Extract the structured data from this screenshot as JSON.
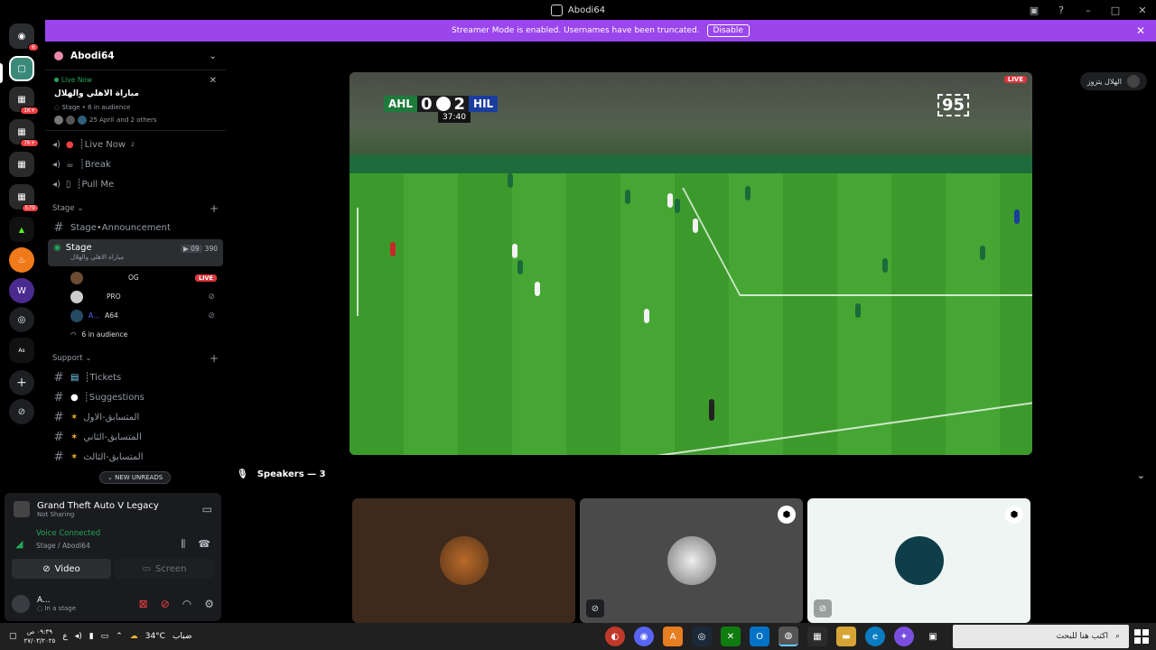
{
  "window": {
    "title": "Abodi64"
  },
  "banner": {
    "text": "Streamer Mode is enabled. Usernames have been truncated.",
    "disable_label": "Disable"
  },
  "rail": {
    "home_badge": "6",
    "badges": [
      "1K+",
      "7K+",
      "579"
    ]
  },
  "server": {
    "name": "Abodi64"
  },
  "live_now": {
    "label": "Live Now",
    "title": "مباراة الاهلي والهلال",
    "meta": "Stage • 6 in audience",
    "date_text": "25 April",
    "others": "and 2 others"
  },
  "channels_top": [
    {
      "name": "┊Live Now",
      "sup": "2"
    },
    {
      "name": "┊Break"
    },
    {
      "name": "┊Pull Me"
    }
  ],
  "stage_category": "Stage",
  "announcement_channel": "Stage•Announcement",
  "stage_channel": {
    "name": "Stage",
    "subtitle": "مباراة الاهلي والهلال",
    "count_a": "09",
    "count_b": "390"
  },
  "stage_members": [
    {
      "tag": "OG",
      "live": "LIVE"
    },
    {
      "tag": "PRO"
    },
    {
      "name": "A...",
      "tag": "A64"
    }
  ],
  "audience": "6 in audience",
  "support_category": "Support",
  "support_channels": [
    {
      "name": "┊Tickets"
    },
    {
      "name": "┊Suggestions"
    },
    {
      "name": "المتسابق-الاول"
    },
    {
      "name": "المتسابق-الثاني"
    },
    {
      "name": "المتسابق-الثالث"
    }
  ],
  "new_unreads": "NEW UNREADS",
  "activity": {
    "game": "Grand Theft Auto V Legacy",
    "status": "Not Sharing"
  },
  "voice": {
    "status": "Voice Connected",
    "channel": "Stage / Abodi64",
    "video_label": "Video",
    "screen_label": "Screen"
  },
  "user": {
    "name": "A...",
    "status": "In a stage"
  },
  "stream": {
    "home": "AHL",
    "home_score": "0",
    "away_score": "2",
    "away": "HIL",
    "clock": "37:40",
    "live": "LIVE",
    "watermark": "95"
  },
  "name_pill": "الهلال يتزوز",
  "speakers": {
    "label": "Speakers — 3"
  },
  "taskbar": {
    "time": "٠٩:٣٩ ص",
    "date": "٢٧/٠٣/٢٠٢٥",
    "lang": "ع",
    "temp": "34°C",
    "weather": "ضباب",
    "search_placeholder": "اكتب هنا للبحث"
  },
  "colors": {
    "accent": "#9b45ed",
    "live": "#da373c",
    "green": "#23a55a"
  }
}
